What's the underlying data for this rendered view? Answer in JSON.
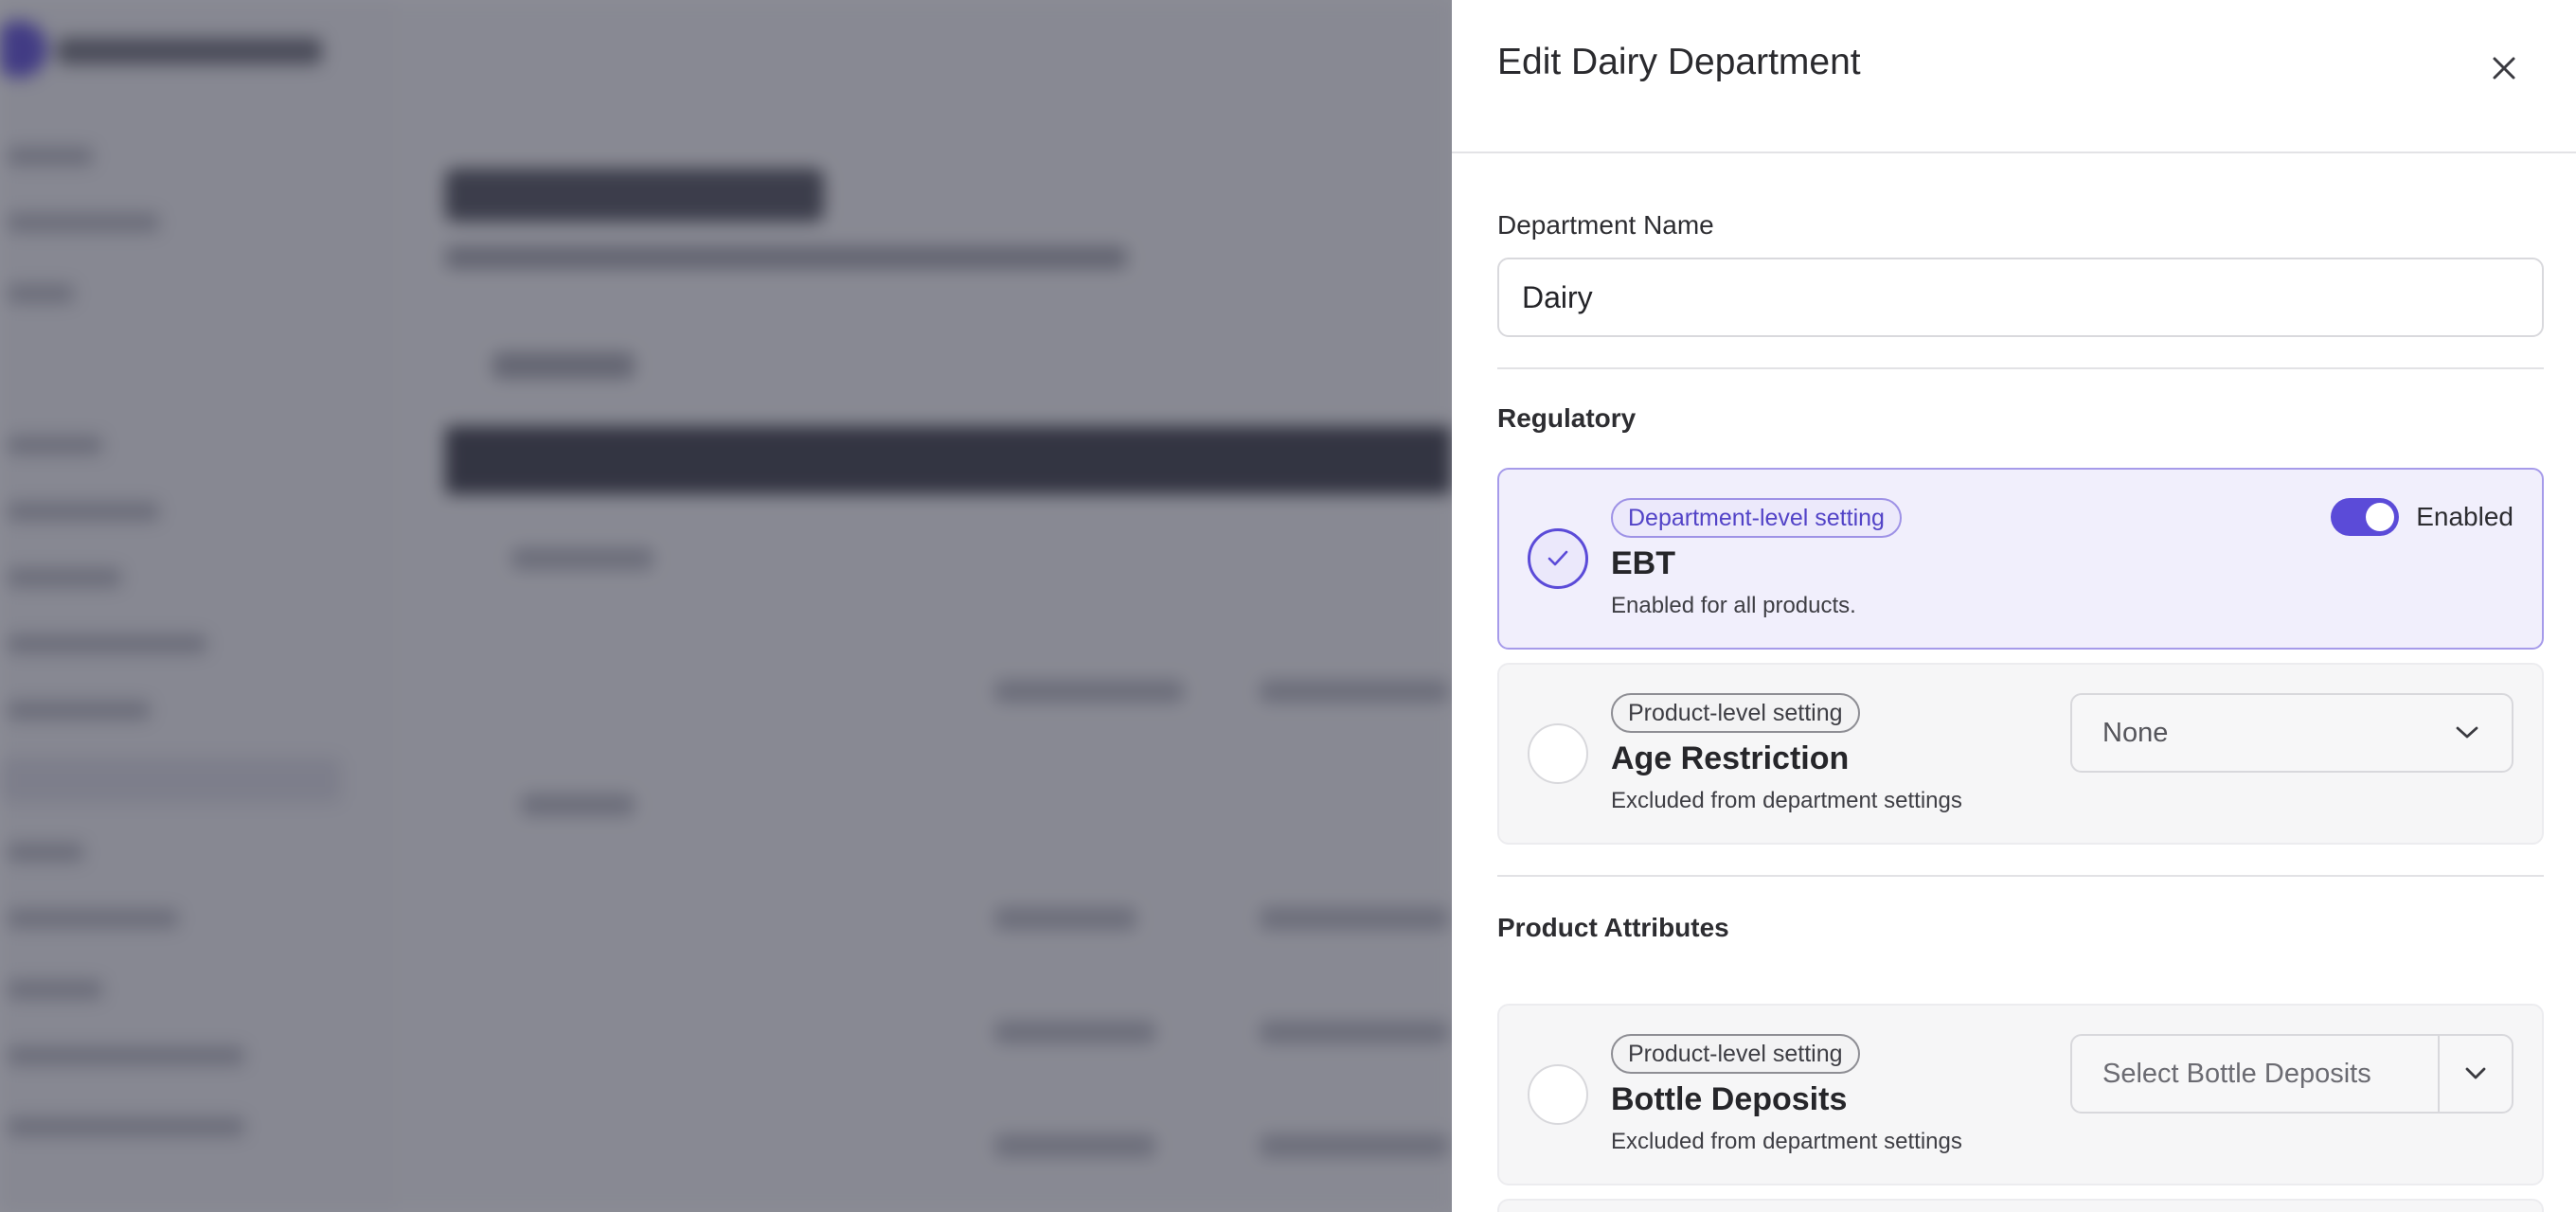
{
  "drawer": {
    "title": "Edit Dairy Department",
    "close_icon": "close-icon"
  },
  "department_name": {
    "label": "Department Name",
    "value": "Dairy"
  },
  "regulatory": {
    "title": "Regulatory",
    "ebt": {
      "badge": "Department-level setting",
      "title": "EBT",
      "description": "Enabled for all products.",
      "toggle_label": "Enabled",
      "enabled": true
    },
    "age_restriction": {
      "badge": "Product-level setting",
      "title": "Age Restriction",
      "description": "Excluded from department settings",
      "select_value": "None"
    }
  },
  "product_attributes": {
    "title": "Product Attributes",
    "bottle_deposits": {
      "badge": "Product-level setting",
      "title": "Bottle Deposits",
      "description": "Excluded from department settings",
      "select_placeholder": "Select Bottle Deposits"
    }
  },
  "colors": {
    "accent": "#5b4bd8",
    "active_card_bg": "#f1effc",
    "overlay": "#2e3040"
  }
}
